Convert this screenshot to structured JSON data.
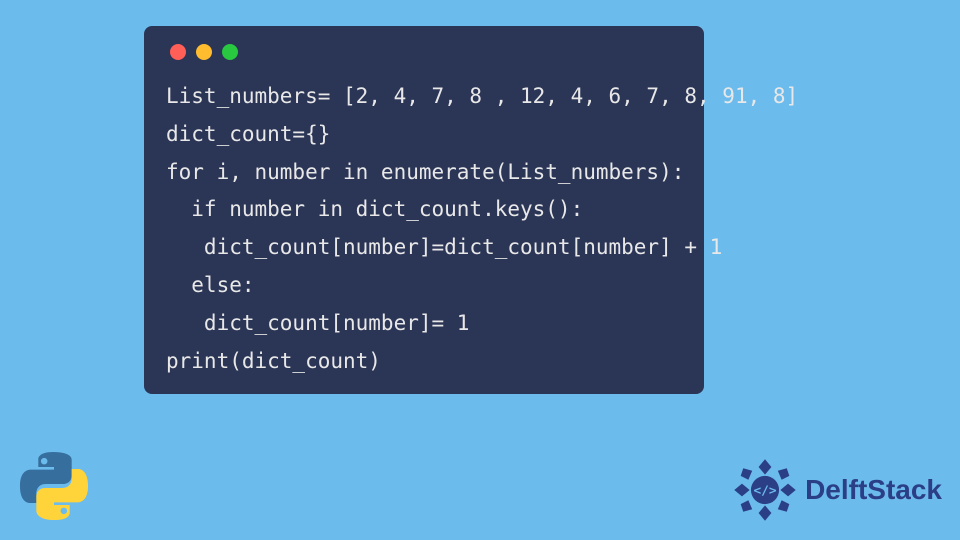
{
  "code": {
    "line1": "List_numbers= [2, 4, 7, 8 , 12, 4, 6, 7, 8, 91, 8]",
    "line2": "dict_count={}",
    "line3": "for i, number in enumerate(List_numbers):",
    "line4": "  if number in dict_count.keys():",
    "line5": "   dict_count[number]=dict_count[number] + 1",
    "line6": "  else:",
    "line7": "   dict_count[number]= 1",
    "line8": "print(dict_count)"
  },
  "branding": {
    "name": "DelftStack"
  },
  "colors": {
    "background": "#6cbbed",
    "window": "#2b3556",
    "code_text": "#e8e8e8",
    "traffic_red": "#ff5f57",
    "traffic_yellow": "#febc2e",
    "traffic_green": "#28c840",
    "brand_blue": "#2b3f87"
  }
}
